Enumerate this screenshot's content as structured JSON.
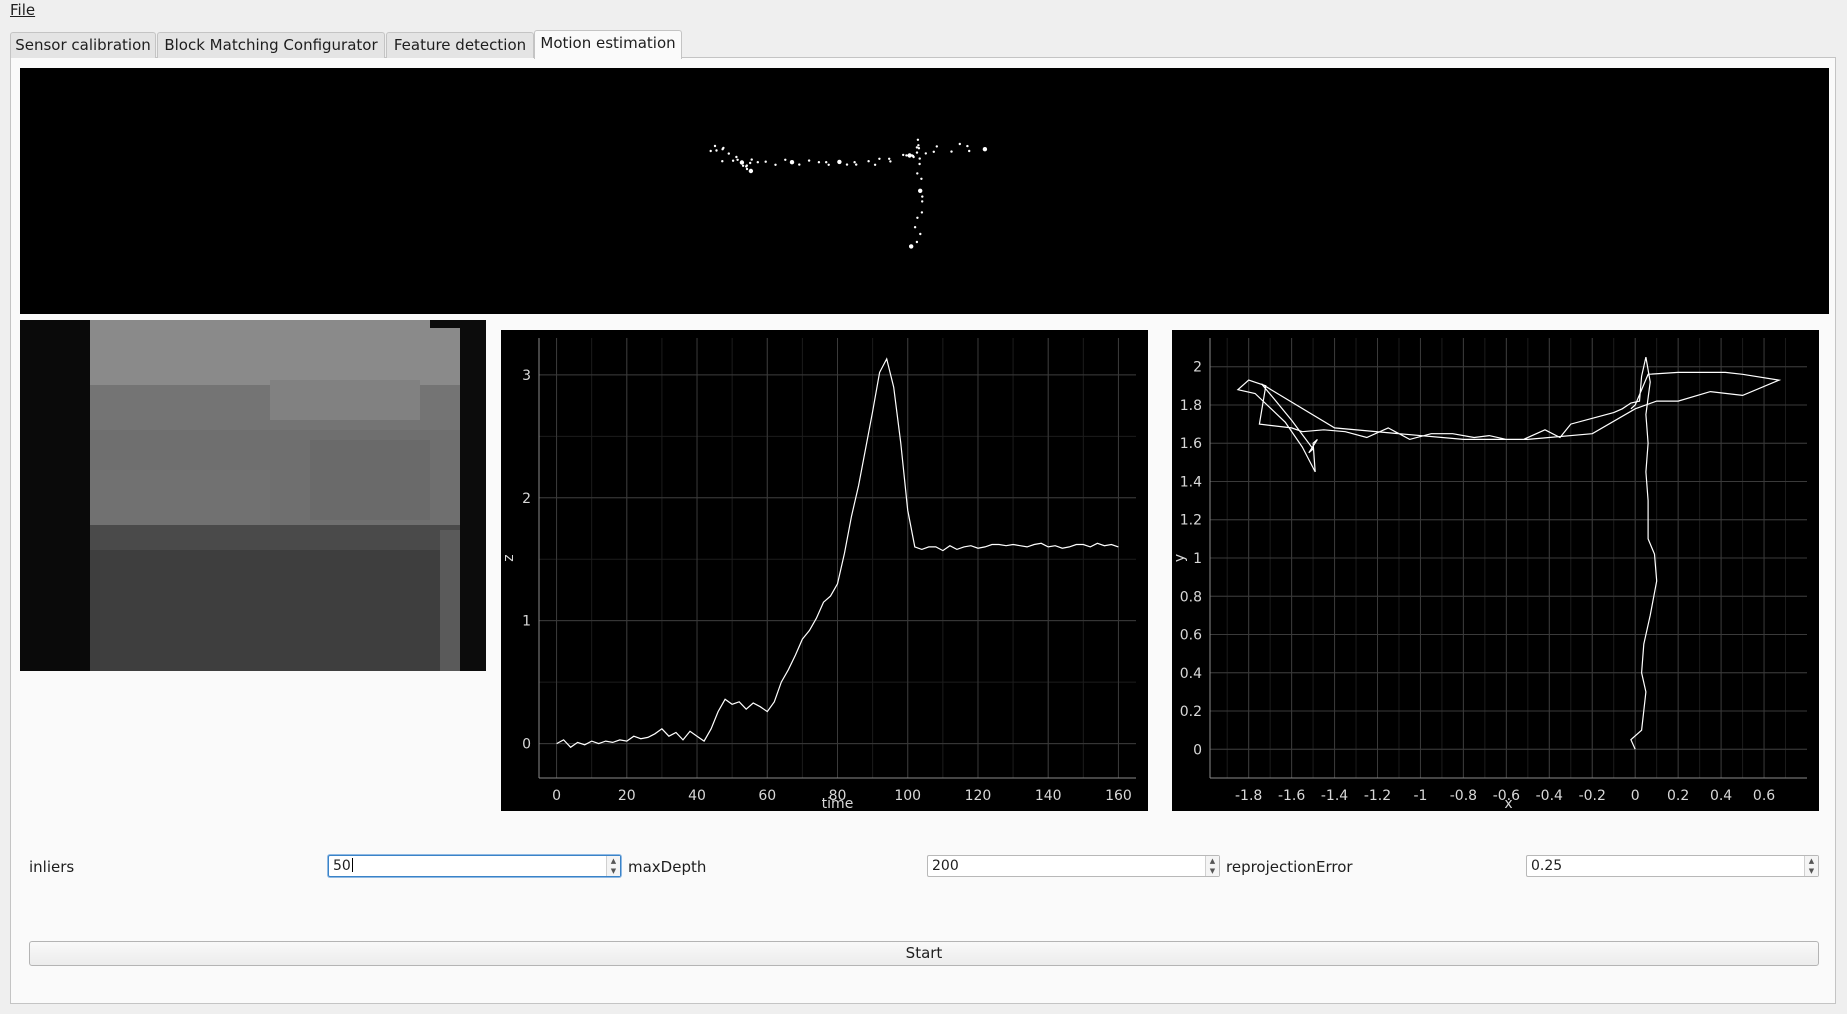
{
  "menubar": {
    "items": [
      {
        "label": "File"
      }
    ]
  },
  "tabs": [
    {
      "label": "Sensor calibration"
    },
    {
      "label": "Block Matching Configurator"
    },
    {
      "label": "Feature detection"
    },
    {
      "label": "Motion estimation",
      "active": true
    }
  ],
  "params": [
    {
      "label": "inliers",
      "value": "50",
      "focused": true
    },
    {
      "label": "maxDepth",
      "value": "200"
    },
    {
      "label": "reprojectionError",
      "value": "0.25"
    }
  ],
  "start_label": "Start",
  "colors": {
    "plot_background": "#000000",
    "plot_line": "#ffffff",
    "focus_border": "#3a83c8"
  },
  "chart_data": [
    {
      "type": "line",
      "xlabel": "time",
      "ylabel": "z",
      "xlim": [
        -5,
        165
      ],
      "ylim": [
        -0.28,
        3.3
      ],
      "x_ticks": [
        "0",
        "20",
        "40",
        "60",
        "80",
        "100",
        "120",
        "140",
        "160"
      ],
      "y_ticks": [
        "0",
        "1",
        "2",
        "3"
      ],
      "grid": true,
      "series": [
        {
          "x": [
            0,
            2,
            4,
            6,
            8,
            10,
            12,
            14,
            16,
            18,
            20,
            22,
            24,
            26,
            28,
            30,
            32,
            34,
            36,
            38,
            40,
            42,
            44,
            46,
            48,
            50,
            52,
            54,
            56,
            58,
            60,
            62,
            64,
            66,
            68,
            70,
            72,
            74,
            76,
            78,
            80,
            82,
            84,
            86,
            88,
            90,
            92,
            94,
            96,
            98,
            100,
            102,
            104,
            106,
            108,
            110,
            112,
            114,
            116,
            118,
            120,
            122,
            124,
            126,
            128,
            130,
            132,
            134,
            136,
            138,
            140,
            142,
            144,
            146,
            148,
            150,
            152,
            154,
            156,
            158,
            160
          ],
          "y": [
            0,
            0.03,
            -0.03,
            0.01,
            -0.01,
            0.02,
            0.0,
            0.02,
            0.01,
            0.03,
            0.02,
            0.06,
            0.04,
            0.05,
            0.08,
            0.12,
            0.06,
            0.09,
            0.03,
            0.1,
            0.06,
            0.02,
            0.12,
            0.26,
            0.36,
            0.32,
            0.34,
            0.28,
            0.33,
            0.3,
            0.26,
            0.34,
            0.5,
            0.6,
            0.72,
            0.85,
            0.92,
            1.02,
            1.15,
            1.2,
            1.3,
            1.55,
            1.85,
            2.1,
            2.4,
            2.7,
            3.02,
            3.13,
            2.9,
            2.45,
            1.9,
            1.6,
            1.58,
            1.6,
            1.6,
            1.57,
            1.61,
            1.58,
            1.6,
            1.61,
            1.59,
            1.6,
            1.62,
            1.62,
            1.61,
            1.62,
            1.61,
            1.6,
            1.62,
            1.63,
            1.6,
            1.61,
            1.59,
            1.6,
            1.62,
            1.62,
            1.6,
            1.63,
            1.61,
            1.62,
            1.6
          ]
        }
      ]
    },
    {
      "type": "line",
      "xlabel": "x",
      "ylabel": "y",
      "xlim": [
        -1.98,
        0.8
      ],
      "ylim": [
        -0.15,
        2.15
      ],
      "x_ticks": [
        "-1.8",
        "-1.6",
        "-1.4",
        "-1.2",
        "-1",
        "-0.8",
        "-0.6",
        "-0.4",
        "-0.2",
        "0",
        "0.2",
        "0.4",
        "0.6"
      ],
      "y_ticks": [
        "0",
        "0.2",
        "0.4",
        "0.6",
        "0.8",
        "1",
        "1.2",
        "1.4",
        "1.6",
        "1.8",
        "2"
      ],
      "grid": true,
      "series": [
        {
          "x": [
            0,
            -0.02,
            0.03,
            0.05,
            0.03,
            0.04,
            0.07,
            0.1,
            0.09,
            0.06,
            0.06,
            0.05,
            0.06,
            0.05,
            0.07,
            0.05,
            0.03,
            0.02,
            -0.02,
            -0.06,
            -0.1,
            -0.2,
            -0.3,
            -0.35,
            -0.42,
            -0.52,
            -0.6,
            -0.68,
            -0.75,
            -0.85,
            -0.95,
            -1.05,
            -1.15,
            -1.25,
            -1.35,
            -1.45,
            -1.55,
            -1.6,
            -1.75,
            -1.72,
            -1.8,
            -1.85,
            -1.77,
            -1.63,
            -1.55,
            -1.49,
            -1.5,
            -1.48,
            -1.52,
            -1.5,
            -1.6,
            -1.68,
            -1.74,
            -1.4,
            -1.1,
            -0.8,
            -0.5,
            -0.2,
            0.0,
            0.1,
            0.2,
            0.35,
            0.5,
            0.67,
            0.5,
            0.42,
            0.2,
            0.06,
            0.0,
            -0.02
          ],
          "y": [
            0,
            0.05,
            0.1,
            0.3,
            0.4,
            0.55,
            0.7,
            0.88,
            1.02,
            1.1,
            1.3,
            1.45,
            1.6,
            1.75,
            1.92,
            2.05,
            1.95,
            1.82,
            1.81,
            1.78,
            1.76,
            1.73,
            1.7,
            1.63,
            1.67,
            1.62,
            1.62,
            1.64,
            1.63,
            1.65,
            1.65,
            1.62,
            1.68,
            1.63,
            1.66,
            1.67,
            1.66,
            1.68,
            1.7,
            1.9,
            1.93,
            1.88,
            1.86,
            1.71,
            1.58,
            1.45,
            1.6,
            1.62,
            1.55,
            1.57,
            1.72,
            1.83,
            1.91,
            1.68,
            1.65,
            1.62,
            1.62,
            1.65,
            1.78,
            1.82,
            1.82,
            1.87,
            1.85,
            1.93,
            1.96,
            1.97,
            1.97,
            1.96,
            1.8,
            1.78
          ]
        }
      ]
    }
  ]
}
